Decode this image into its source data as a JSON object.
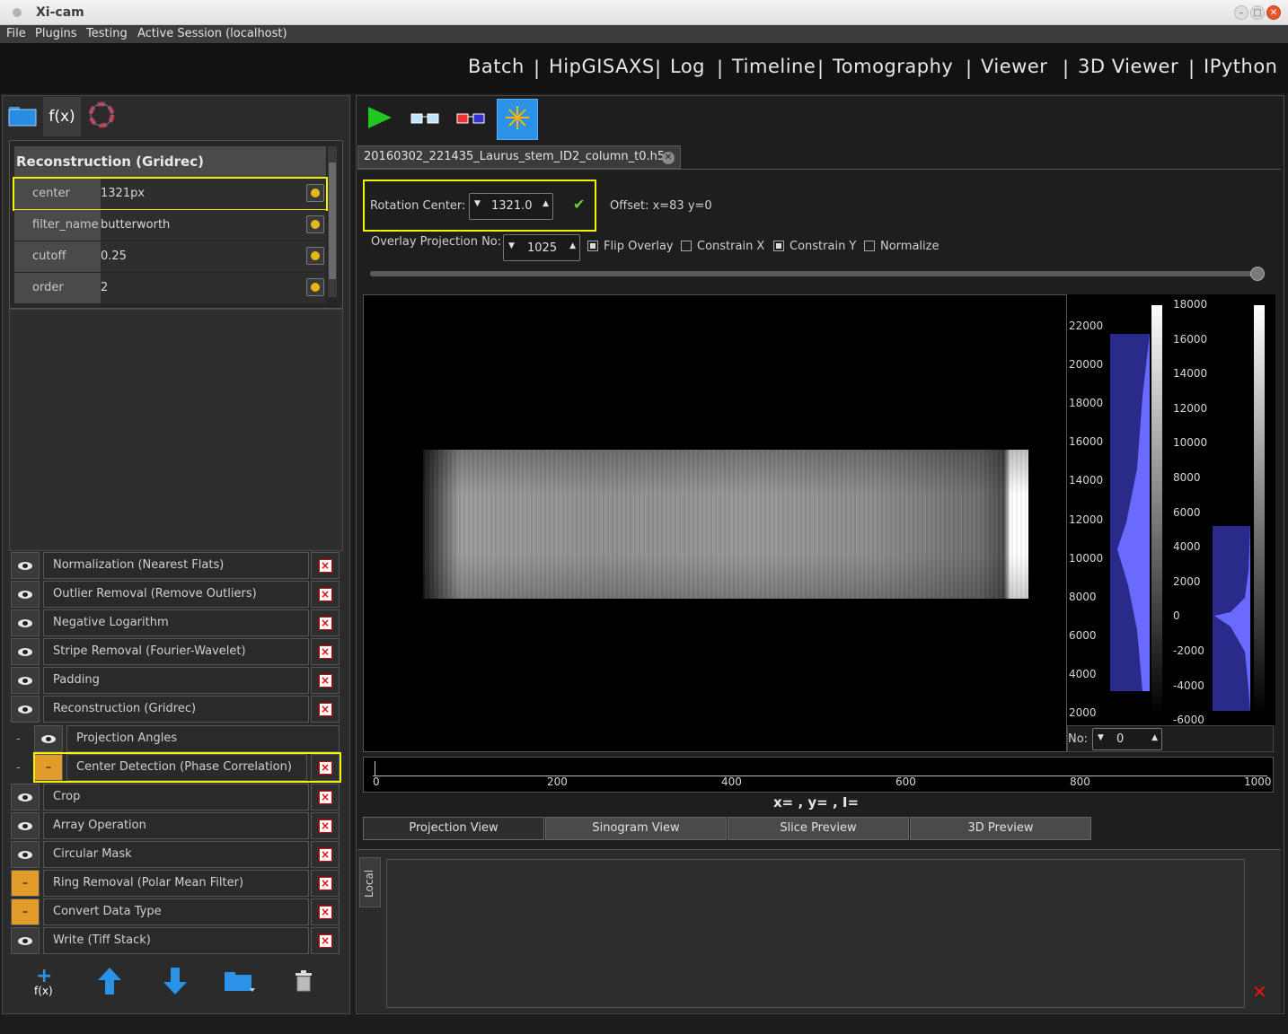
{
  "window": {
    "title": "Xi-cam"
  },
  "menu": [
    "File",
    "Plugins",
    "Testing",
    "Active Session (localhost)"
  ],
  "plugins": [
    "Batch",
    "HipGISAXS",
    "Log",
    "Timeline",
    "Tomography",
    "Viewer",
    "3D Viewer",
    "IPython"
  ],
  "left": {
    "tabs": {
      "fx_label": "f(x)"
    },
    "params": {
      "header": "Reconstruction (Gridrec)",
      "rows": [
        {
          "key": "center",
          "value": "1321px"
        },
        {
          "key": "filter_name",
          "value": "butterworth"
        },
        {
          "key": "cutoff",
          "value": "0.25"
        },
        {
          "key": "order",
          "value": "2"
        }
      ]
    },
    "functions": [
      {
        "name": "Normalization (Nearest Flats)",
        "visible": true
      },
      {
        "name": "Outlier Removal (Remove Outliers)",
        "visible": true
      },
      {
        "name": "Negative Logarithm",
        "visible": true
      },
      {
        "name": "Stripe Removal (Fourier-Wavelet)",
        "visible": true
      },
      {
        "name": "Padding",
        "visible": true
      },
      {
        "name": "Reconstruction (Gridrec)",
        "visible": true
      },
      {
        "name": "Projection Angles",
        "visible": true,
        "dash": "-"
      },
      {
        "name": "Center Detection (Phase Correlation)",
        "visible": false,
        "dash": "-"
      },
      {
        "name": "Crop",
        "visible": true
      },
      {
        "name": "Array Operation",
        "visible": true
      },
      {
        "name": "Circular Mask",
        "visible": true
      },
      {
        "name": "Ring Removal (Polar Mean Filter)",
        "visible": false
      },
      {
        "name": "Convert Data Type",
        "visible": false
      },
      {
        "name": "Write (Tiff Stack)",
        "visible": true
      }
    ],
    "bottom_toolbar": {
      "add_label": "f(x)"
    }
  },
  "right": {
    "file_tab": "20160302_221435_Laurus_stem_ID2_column_t0.h5",
    "rotation_center": {
      "label": "Rotation Center:",
      "value": "1321.0"
    },
    "offset": "Offset: x=83   y=0",
    "overlay": {
      "label": "Overlay Projection No:",
      "value": "1025",
      "options": [
        {
          "label": "Flip Overlay",
          "checked": true
        },
        {
          "label": "Constrain X",
          "checked": false
        },
        {
          "label": "Constrain Y",
          "checked": true
        },
        {
          "label": "Normalize",
          "checked": false
        }
      ]
    },
    "hist1_ticks": [
      "22000",
      "20000",
      "18000",
      "16000",
      "14000",
      "12000",
      "10000",
      "8000",
      "6000",
      "4000",
      "2000"
    ],
    "hist2_ticks": [
      "18000",
      "16000",
      "14000",
      "12000",
      "10000",
      "8000",
      "6000",
      "4000",
      "2000",
      "0",
      "-2000",
      "-4000",
      "-6000"
    ],
    "no": {
      "label": "No:",
      "value": "0"
    },
    "xaxis_ticks": [
      "0",
      "200",
      "400",
      "600",
      "800",
      "1000"
    ],
    "coords": "x= , y= , I=",
    "view_tabs": [
      "Projection View",
      "Sinogram View",
      "Slice Preview",
      "3D Preview"
    ],
    "console_tab": "Local"
  },
  "colors": {
    "highlight": "#f2f200",
    "accent": "#2a93e8",
    "play": "#22c622"
  }
}
